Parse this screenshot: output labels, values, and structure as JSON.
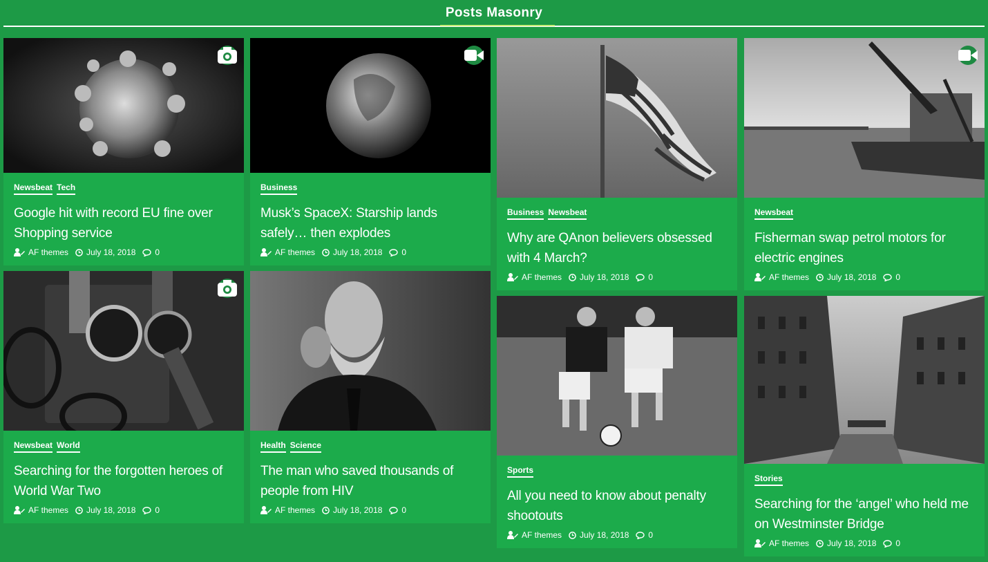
{
  "section_title": "Posts Masonry",
  "posts": [
    {
      "title": "Google hit with record EU fine over Shopping service",
      "categories": [
        "Newsbeat",
        "Tech"
      ],
      "author": "AF themes",
      "date": "July 18, 2018",
      "comments": "0",
      "format": "camera-icon",
      "image": "virus-image"
    },
    {
      "title": "Musk’s SpaceX: Starship lands safely… then explodes",
      "categories": [
        "Business"
      ],
      "author": "AF themes",
      "date": "July 18, 2018",
      "comments": "0",
      "format": "video-icon",
      "image": "earth-image"
    },
    {
      "title": "Why are QAnon believers obsessed with 4 March?",
      "categories": [
        "Business",
        "Newsbeat"
      ],
      "author": "AF themes",
      "date": "July 18, 2018",
      "comments": "0",
      "format": "",
      "image": "flag-image"
    },
    {
      "title": "Fisherman swap petrol motors for electric engines",
      "categories": [
        "Newsbeat"
      ],
      "author": "AF themes",
      "date": "July 18, 2018",
      "comments": "0",
      "format": "video-icon",
      "image": "crane-boat-image"
    },
    {
      "title": "Searching for the forgotten heroes of World War Two",
      "categories": [
        "Newsbeat",
        "World"
      ],
      "author": "AF themes",
      "date": "July 18, 2018",
      "comments": "0",
      "format": "camera-icon",
      "image": "watches-image"
    },
    {
      "title": "The man who saved thousands of people from HIV",
      "categories": [
        "Health",
        "Science"
      ],
      "author": "AF themes",
      "date": "July 18, 2018",
      "comments": "0",
      "format": "",
      "image": "bearded-man-image"
    },
    {
      "title": "All you need to know about penalty shootouts",
      "categories": [
        "Sports"
      ],
      "author": "AF themes",
      "date": "July 18, 2018",
      "comments": "0",
      "format": "",
      "image": "soccer-image"
    },
    {
      "title": "Searching for the ‘angel’ who held me on Westminster Bridge",
      "categories": [
        "Stories"
      ],
      "author": "AF themes",
      "date": "July 18, 2018",
      "comments": "0",
      "format": "",
      "image": "canal-buildings-image"
    }
  ],
  "colors": {
    "background": "#1d9a46",
    "card": "#1cab4b",
    "badge": "#1e8a42",
    "accent": "#c8f075"
  }
}
